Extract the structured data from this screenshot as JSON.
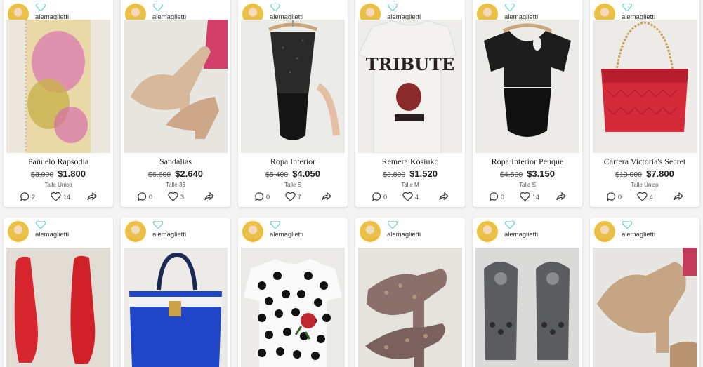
{
  "cards": [
    {
      "user": "alemaglietti",
      "title": "Pañuelo Rapsodia",
      "old_price": "$3.000",
      "price": "$1.800",
      "size": "Talle Único",
      "comments": "2",
      "likes": "14"
    },
    {
      "user": "alemaglietti",
      "title": "Sandalias",
      "old_price": "$6.600",
      "price": "$2.640",
      "size": "Talle 36",
      "comments": "0",
      "likes": "3"
    },
    {
      "user": "alemaglietti",
      "title": "Ropa Interior",
      "old_price": "$5.400",
      "price": "$4.050",
      "size": "Talle S",
      "comments": "0",
      "likes": "7"
    },
    {
      "user": "alemaglietti",
      "title": "Remera Kosiuko",
      "old_price": "$3.800",
      "price": "$1.520",
      "size": "Talle M",
      "comments": "0",
      "likes": "4"
    },
    {
      "user": "alemaglietti",
      "title": "Ropa Interior Peuque",
      "old_price": "$4.500",
      "price": "$3.150",
      "size": "Talle S",
      "comments": "0",
      "likes": "14"
    },
    {
      "user": "alemaglietti",
      "title": "Cartera Victoria's Secret",
      "old_price": "$13.000",
      "price": "$7.800",
      "size": "Talle Único",
      "comments": "0",
      "likes": "4"
    }
  ],
  "cards2": [
    {
      "user": "alemaglietti"
    },
    {
      "user": "alemaglietti"
    },
    {
      "user": "alemaglietti"
    },
    {
      "user": "alemaglietti"
    },
    {
      "user": "alemaglietti"
    },
    {
      "user": "alemaglietti"
    }
  ],
  "photo_texts": {
    "tribute": "TRIBUTE"
  },
  "colors": {
    "gem": "#5fd3c6",
    "background": "#f4f4f4"
  }
}
